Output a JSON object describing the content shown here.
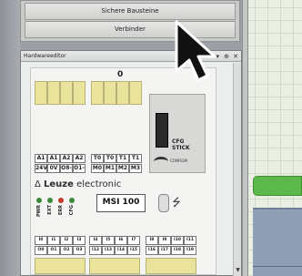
{
  "tabs": {
    "sichere_bausteine": "Sichere Bausteine",
    "verbinder": "Verbinder"
  },
  "panel": {
    "title": "Hardwareeditor",
    "buttons": [
      "▾",
      "⊕",
      "✕"
    ]
  },
  "device": {
    "module_number": "0",
    "top_terminals": [
      "A1",
      "A1",
      "A2",
      "A2",
      "T0",
      "T0",
      "T1",
      "T1"
    ],
    "input_labels_row1": [
      "A1",
      "A1",
      "A2",
      "A2",
      "T0",
      "T0",
      "T1",
      "T1"
    ],
    "input_labels_row2": [
      "24V",
      "0V",
      "O8-",
      "O1-",
      "M0",
      "M1",
      "M2",
      "M3"
    ],
    "cfg_stick": "CFG\nSTICK",
    "cfg_subtext": "CONFIGM",
    "brand_symbol": "Δ",
    "brand_name": "Leuze",
    "brand_suffix": "electronic",
    "led_labels": [
      "PWR",
      "EXT",
      "ERR",
      "CFG"
    ],
    "led_colors": [
      "#3a8a3a",
      "#3a8a3a",
      "#c23a2a",
      "#3a8a3a"
    ],
    "model": "MSI 100",
    "usb_icon": "⭍",
    "bottom_labels_row1": [
      "I0",
      "I1",
      "I2",
      "I3",
      "I4",
      "I5",
      "I6",
      "I7",
      "I8",
      "I9",
      "I10",
      "I11"
    ],
    "bottom_labels_row2": [
      "O0",
      "O1",
      "O2",
      "O3",
      "I12",
      "I13",
      "I14",
      "I15",
      "I16",
      "I17",
      "I18",
      "I19"
    ],
    "accent_colors": {
      "terminal": "#e9e39c",
      "led_green": "#3a8a3a",
      "led_red": "#c23a2a",
      "canvas_button": "#5cb84a",
      "lower_panel": "#8e9fb6"
    }
  }
}
